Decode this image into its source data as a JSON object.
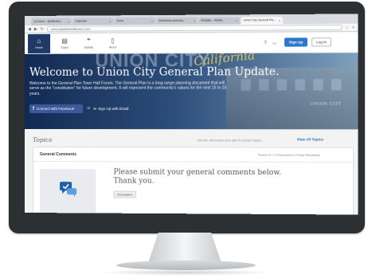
{
  "browser": {
    "tabs": [
      {
        "label": "(1) Inbox - @willclear..."
      },
      {
        "label": "Calendar"
      },
      {
        "label": "Drive"
      },
      {
        "label": "Workshop submiss..."
      },
      {
        "label": "Website - Mobile"
      },
      {
        "label": "Union City General Pla..."
      }
    ],
    "url": "unioncitytownhallforum.com"
  },
  "site_nav": {
    "items": [
      {
        "label": "Home",
        "icon": "home-icon"
      },
      {
        "label": "Topics",
        "icon": "topics-icon"
      },
      {
        "label": "Activity",
        "icon": "activity-icon"
      },
      {
        "label": "About",
        "icon": "about-icon"
      }
    ],
    "signup_label": "Sign Up",
    "login_label": "Log In",
    "lang_label": "En"
  },
  "hero": {
    "wordmark": "UNION CITY",
    "script": "California",
    "title": "Welcome to Union City General Plan Update.",
    "description": "Welcome to the General Plan Town Hall Forum. The General Plan is a long-range planning document that will serve as the \"constitution\" for future development. It will represent the community's values for the next 15 to 25 years.",
    "facebook_label": "Connect with Facebook",
    "or_label": "or",
    "email_label": "Sign Up with Email",
    "building_sign": "UNION CITY"
  },
  "topics": {
    "heading": "Topics",
    "join_text": "Join the discussion and add to current topics.",
    "view_all": "View All Topics",
    "card": {
      "title": "General Comments",
      "meta": "Posted 24 T   0 Discussions   10 Days Remaining",
      "prompt": "Please submit your general comments below. Thank you.",
      "desc_button": "Description"
    }
  },
  "colors": {
    "accent": "#2c77c8",
    "nav_active": "#1f3a66",
    "facebook": "#3b5998",
    "bezel": "#2d3033"
  }
}
